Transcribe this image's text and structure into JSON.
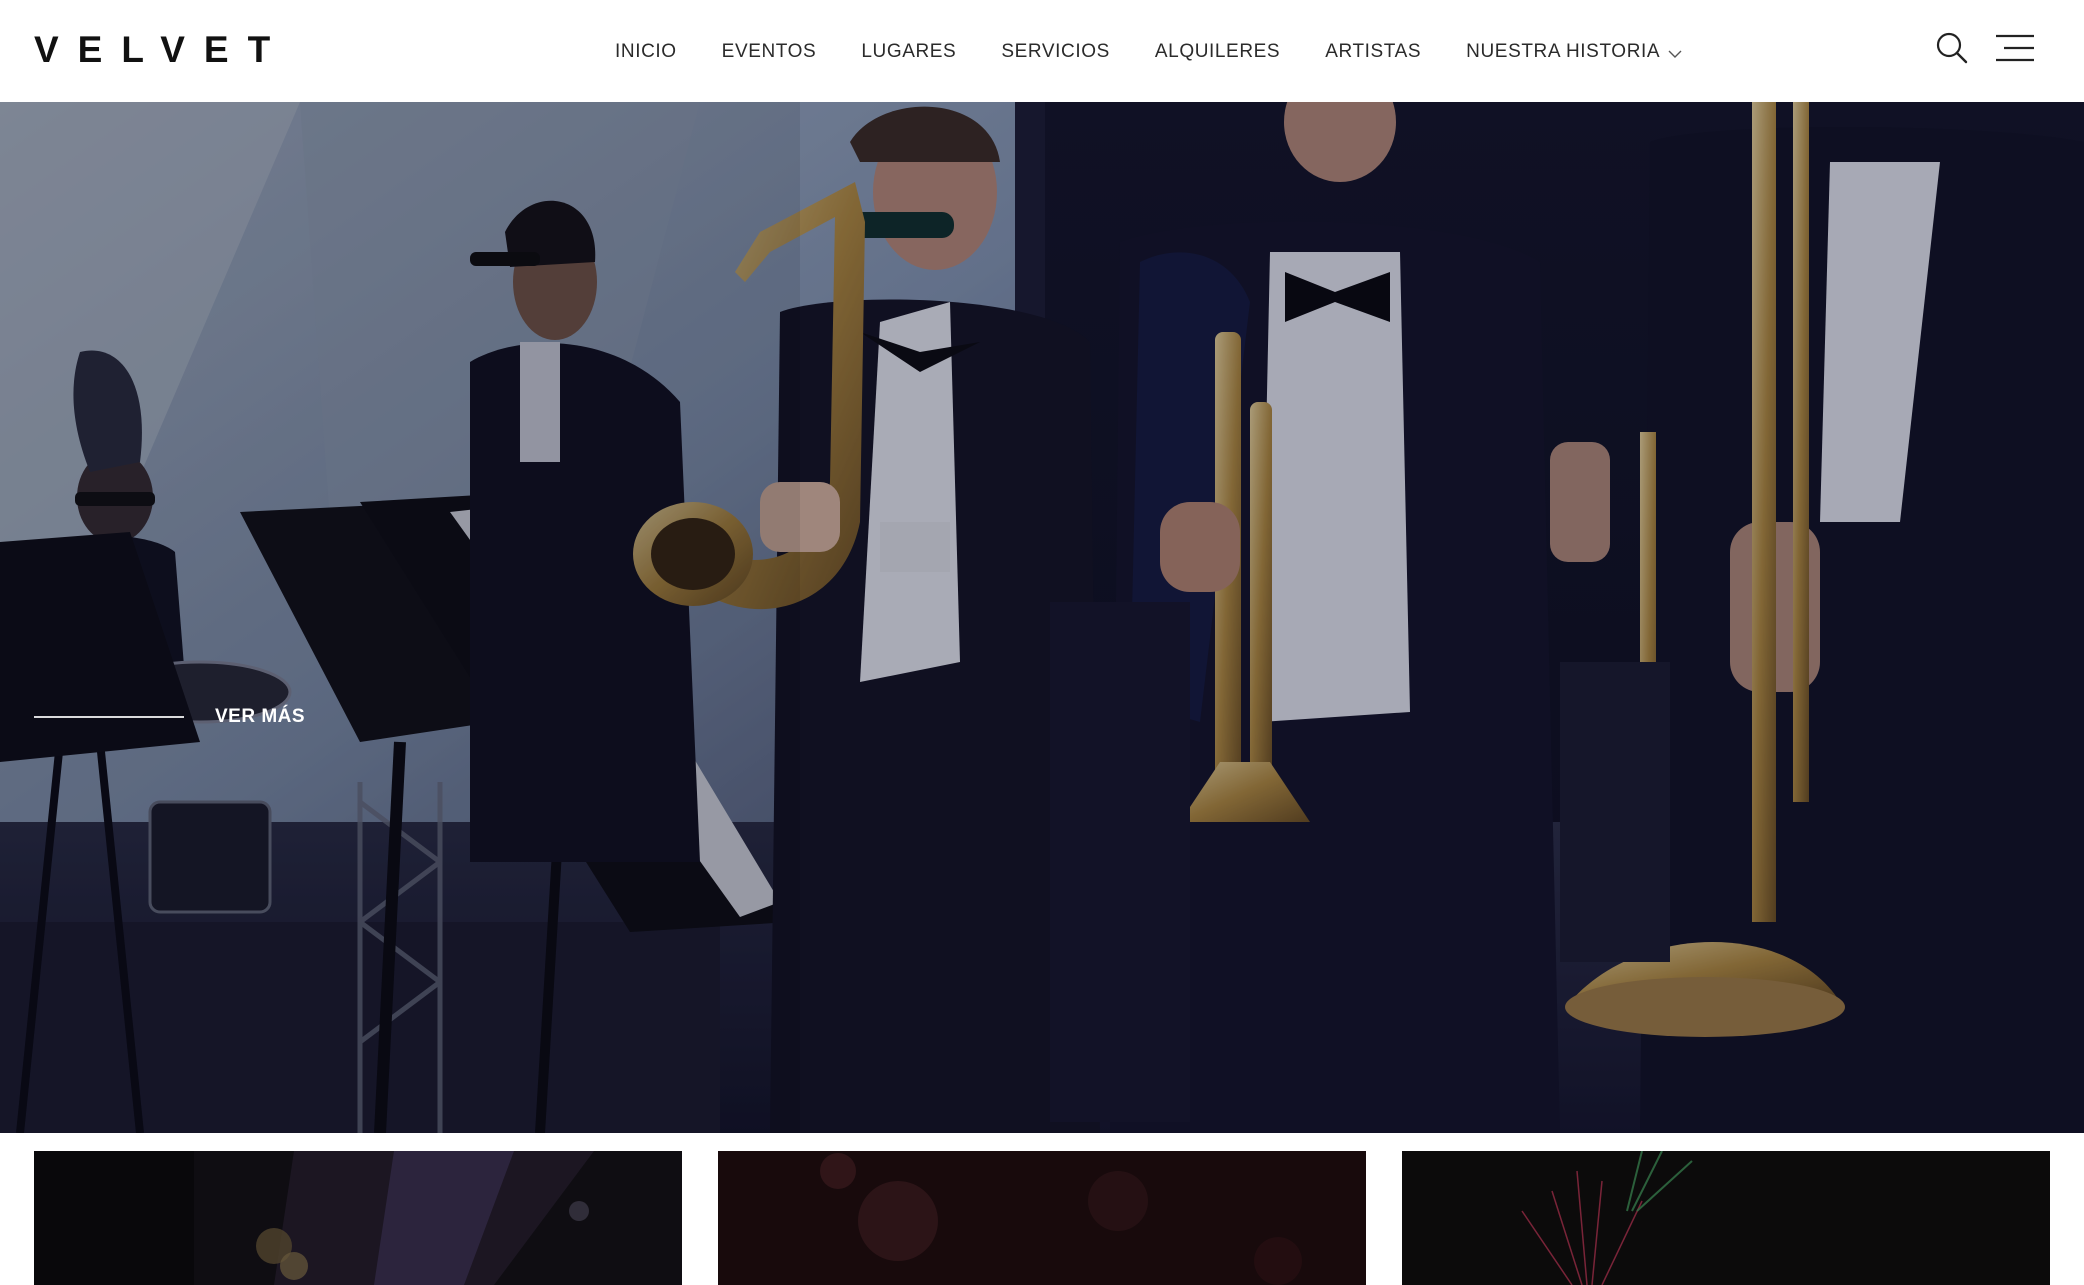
{
  "brand": {
    "logo_text": "VELVET"
  },
  "nav": {
    "items": [
      {
        "label": "INICIO"
      },
      {
        "label": "EVENTOS"
      },
      {
        "label": "LUGARES"
      },
      {
        "label": "SERVICIOS"
      },
      {
        "label": "ALQUILERES"
      },
      {
        "label": "ARTISTAS"
      },
      {
        "label": "NUESTRA HISTORIA",
        "has_dropdown": true,
        "icon": "chevron-down-icon"
      }
    ]
  },
  "header_icons": {
    "search": "search-icon",
    "menu": "hamburger-menu-icon"
  },
  "hero": {
    "cta_label": "VER MÁS",
    "image_subject": "big band musicians in tuxedos playing saxophone, trumpet and trombone on stage"
  },
  "cards": [
    {
      "name": "event-card-1",
      "tone": "#151418"
    },
    {
      "name": "event-card-2",
      "tone": "#1e0e10"
    },
    {
      "name": "event-card-3",
      "tone": "#0f0d0e"
    }
  ],
  "colors": {
    "header_bg": "#ffffff",
    "nav_text": "#2b2b2b",
    "logo": "#111111",
    "hero_overlay": "#1a1a30"
  }
}
